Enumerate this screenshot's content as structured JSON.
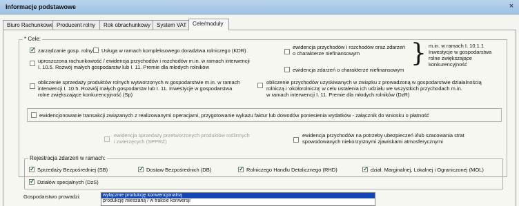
{
  "window": {
    "title": "Informacje podstawowe",
    "close": "×"
  },
  "tabs": [
    "Biuro Rachunkowe",
    "Producent rolny",
    "Rok obrachunkowy",
    "System VAT",
    "Cele/moduły"
  ],
  "cele": {
    "legend": "* Cele:",
    "zarzadzanie": "zarządzanie gosp. rolnym",
    "usluga": "Usługa w ramach kompleksowego doradztwa rolniczego (KDR)",
    "ewid_przych_1": "ewidencja przychodów i rozchodów oraz zdarzeń",
    "ewid_przych_2": "o charakterze niefinansowym",
    "ewid_zdarzen": "ewidencja zdarzeń o charakterze niefinansowym",
    "brace_text_1": "m.in. w ramach I. 10.1.1",
    "brace_text_2": "Inwestycje w gospodarstwa",
    "brace_text_3": "rolne zwiększające",
    "brace_text_4": "konkurencyjność",
    "uproszczona_1": "uproszczona rachunkowość / ewidencja przychodów i rozchodów m.in. w ramach interwencji",
    "uproszczona_2": "I. 10.5. Rozwój małych gospodarstw lub I. 11. Premie dla młodych rolników",
    "obl_sprzedazy_1": "obliczenie sprzedaży produktów rolnych wytworzonych w gospodarstwie  m.in. w ramach",
    "obl_sprzedazy_2": "interwencji I. 10.5. Rozwój małych gospodarstw lub I. 11. Inwestycje w gospodarstwa",
    "obl_sprzedazy_3": "rolne zwiększające konkurencyjność (Sp)",
    "obl_przychodow_1": "obliczenie przychodów uzyskiwanych w związku z prowadzoną w gospodarstwie działalnością",
    "obl_przychodow_2": "rolniczą i 'okołorolniczą' w celu ustalenia ich udziału we wszystkich przychodach m.in.",
    "obl_przychodow_3": "w ramach interwencji I. 11. Premie dla młodych rolników (DzR)",
    "ewid_transakcji": "ewidencjonowanie transakcji związanych z realizowanymi operacjami, przygotowanie wykazu faktur lub dowodów poniesienia wydatków - załącznik do wniosku o płatność",
    "ewid_sprzedazy_1": "ewidencja sprzedaży przetworzonych produktów roślinnych",
    "ewid_sprzedazy_2": "i zwierzęcych (SPPRZ)",
    "ewid_ubezp_1": "ewidencja przychodów na potrzeby ubezpieczeń i/lub szacowania strat",
    "ewid_ubezp_2": "spowodowanych niekorzystnymi zjawiskami atmosferycznymi"
  },
  "rejestracja": {
    "legend": "Rejestracja zdarzeń w ramach:",
    "items": [
      "Sprzedaży Bezpośredniej (SB)",
      "Dostaw Bezpośrednich (DB)",
      "Rolniczego Handlu Detalicznego (RHD)",
      "dział. Marginalnej, Lokalnej i Ograniczonej (MOL)",
      "Działów specjalnych (DzS)"
    ]
  },
  "gospodarstwo": {
    "label": "Gospodarstwo prowadzi:",
    "options": [
      "wyłącznie produkcję konwencjonalną",
      "produkcję mieszaną / w trakcie konwersji"
    ]
  }
}
